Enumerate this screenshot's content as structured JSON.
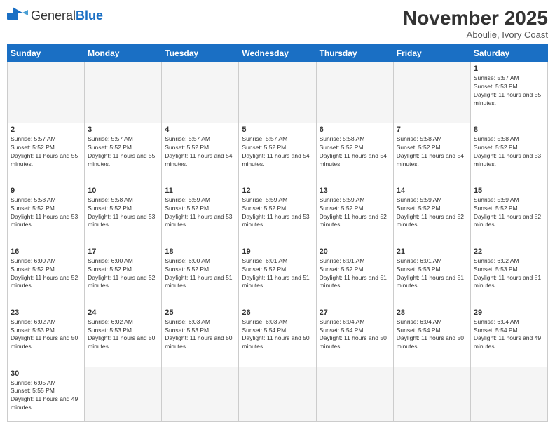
{
  "header": {
    "logo_general": "General",
    "logo_blue": "Blue",
    "month_year": "November 2025",
    "location": "Aboulie, Ivory Coast"
  },
  "weekdays": [
    "Sunday",
    "Monday",
    "Tuesday",
    "Wednesday",
    "Thursday",
    "Friday",
    "Saturday"
  ],
  "days": {
    "1": {
      "sunrise": "5:57 AM",
      "sunset": "5:53 PM",
      "daylight": "11 hours and 55 minutes."
    },
    "2": {
      "sunrise": "5:57 AM",
      "sunset": "5:52 PM",
      "daylight": "11 hours and 55 minutes."
    },
    "3": {
      "sunrise": "5:57 AM",
      "sunset": "5:52 PM",
      "daylight": "11 hours and 55 minutes."
    },
    "4": {
      "sunrise": "5:57 AM",
      "sunset": "5:52 PM",
      "daylight": "11 hours and 54 minutes."
    },
    "5": {
      "sunrise": "5:57 AM",
      "sunset": "5:52 PM",
      "daylight": "11 hours and 54 minutes."
    },
    "6": {
      "sunrise": "5:58 AM",
      "sunset": "5:52 PM",
      "daylight": "11 hours and 54 minutes."
    },
    "7": {
      "sunrise": "5:58 AM",
      "sunset": "5:52 PM",
      "daylight": "11 hours and 54 minutes."
    },
    "8": {
      "sunrise": "5:58 AM",
      "sunset": "5:52 PM",
      "daylight": "11 hours and 53 minutes."
    },
    "9": {
      "sunrise": "5:58 AM",
      "sunset": "5:52 PM",
      "daylight": "11 hours and 53 minutes."
    },
    "10": {
      "sunrise": "5:58 AM",
      "sunset": "5:52 PM",
      "daylight": "11 hours and 53 minutes."
    },
    "11": {
      "sunrise": "5:59 AM",
      "sunset": "5:52 PM",
      "daylight": "11 hours and 53 minutes."
    },
    "12": {
      "sunrise": "5:59 AM",
      "sunset": "5:52 PM",
      "daylight": "11 hours and 53 minutes."
    },
    "13": {
      "sunrise": "5:59 AM",
      "sunset": "5:52 PM",
      "daylight": "11 hours and 52 minutes."
    },
    "14": {
      "sunrise": "5:59 AM",
      "sunset": "5:52 PM",
      "daylight": "11 hours and 52 minutes."
    },
    "15": {
      "sunrise": "5:59 AM",
      "sunset": "5:52 PM",
      "daylight": "11 hours and 52 minutes."
    },
    "16": {
      "sunrise": "6:00 AM",
      "sunset": "5:52 PM",
      "daylight": "11 hours and 52 minutes."
    },
    "17": {
      "sunrise": "6:00 AM",
      "sunset": "5:52 PM",
      "daylight": "11 hours and 52 minutes."
    },
    "18": {
      "sunrise": "6:00 AM",
      "sunset": "5:52 PM",
      "daylight": "11 hours and 51 minutes."
    },
    "19": {
      "sunrise": "6:01 AM",
      "sunset": "5:52 PM",
      "daylight": "11 hours and 51 minutes."
    },
    "20": {
      "sunrise": "6:01 AM",
      "sunset": "5:52 PM",
      "daylight": "11 hours and 51 minutes."
    },
    "21": {
      "sunrise": "6:01 AM",
      "sunset": "5:53 PM",
      "daylight": "11 hours and 51 minutes."
    },
    "22": {
      "sunrise": "6:02 AM",
      "sunset": "5:53 PM",
      "daylight": "11 hours and 51 minutes."
    },
    "23": {
      "sunrise": "6:02 AM",
      "sunset": "5:53 PM",
      "daylight": "11 hours and 50 minutes."
    },
    "24": {
      "sunrise": "6:02 AM",
      "sunset": "5:53 PM",
      "daylight": "11 hours and 50 minutes."
    },
    "25": {
      "sunrise": "6:03 AM",
      "sunset": "5:53 PM",
      "daylight": "11 hours and 50 minutes."
    },
    "26": {
      "sunrise": "6:03 AM",
      "sunset": "5:54 PM",
      "daylight": "11 hours and 50 minutes."
    },
    "27": {
      "sunrise": "6:04 AM",
      "sunset": "5:54 PM",
      "daylight": "11 hours and 50 minutes."
    },
    "28": {
      "sunrise": "6:04 AM",
      "sunset": "5:54 PM",
      "daylight": "11 hours and 50 minutes."
    },
    "29": {
      "sunrise": "6:04 AM",
      "sunset": "5:54 PM",
      "daylight": "11 hours and 49 minutes."
    },
    "30": {
      "sunrise": "6:05 AM",
      "sunset": "5:55 PM",
      "daylight": "11 hours and 49 minutes."
    }
  }
}
